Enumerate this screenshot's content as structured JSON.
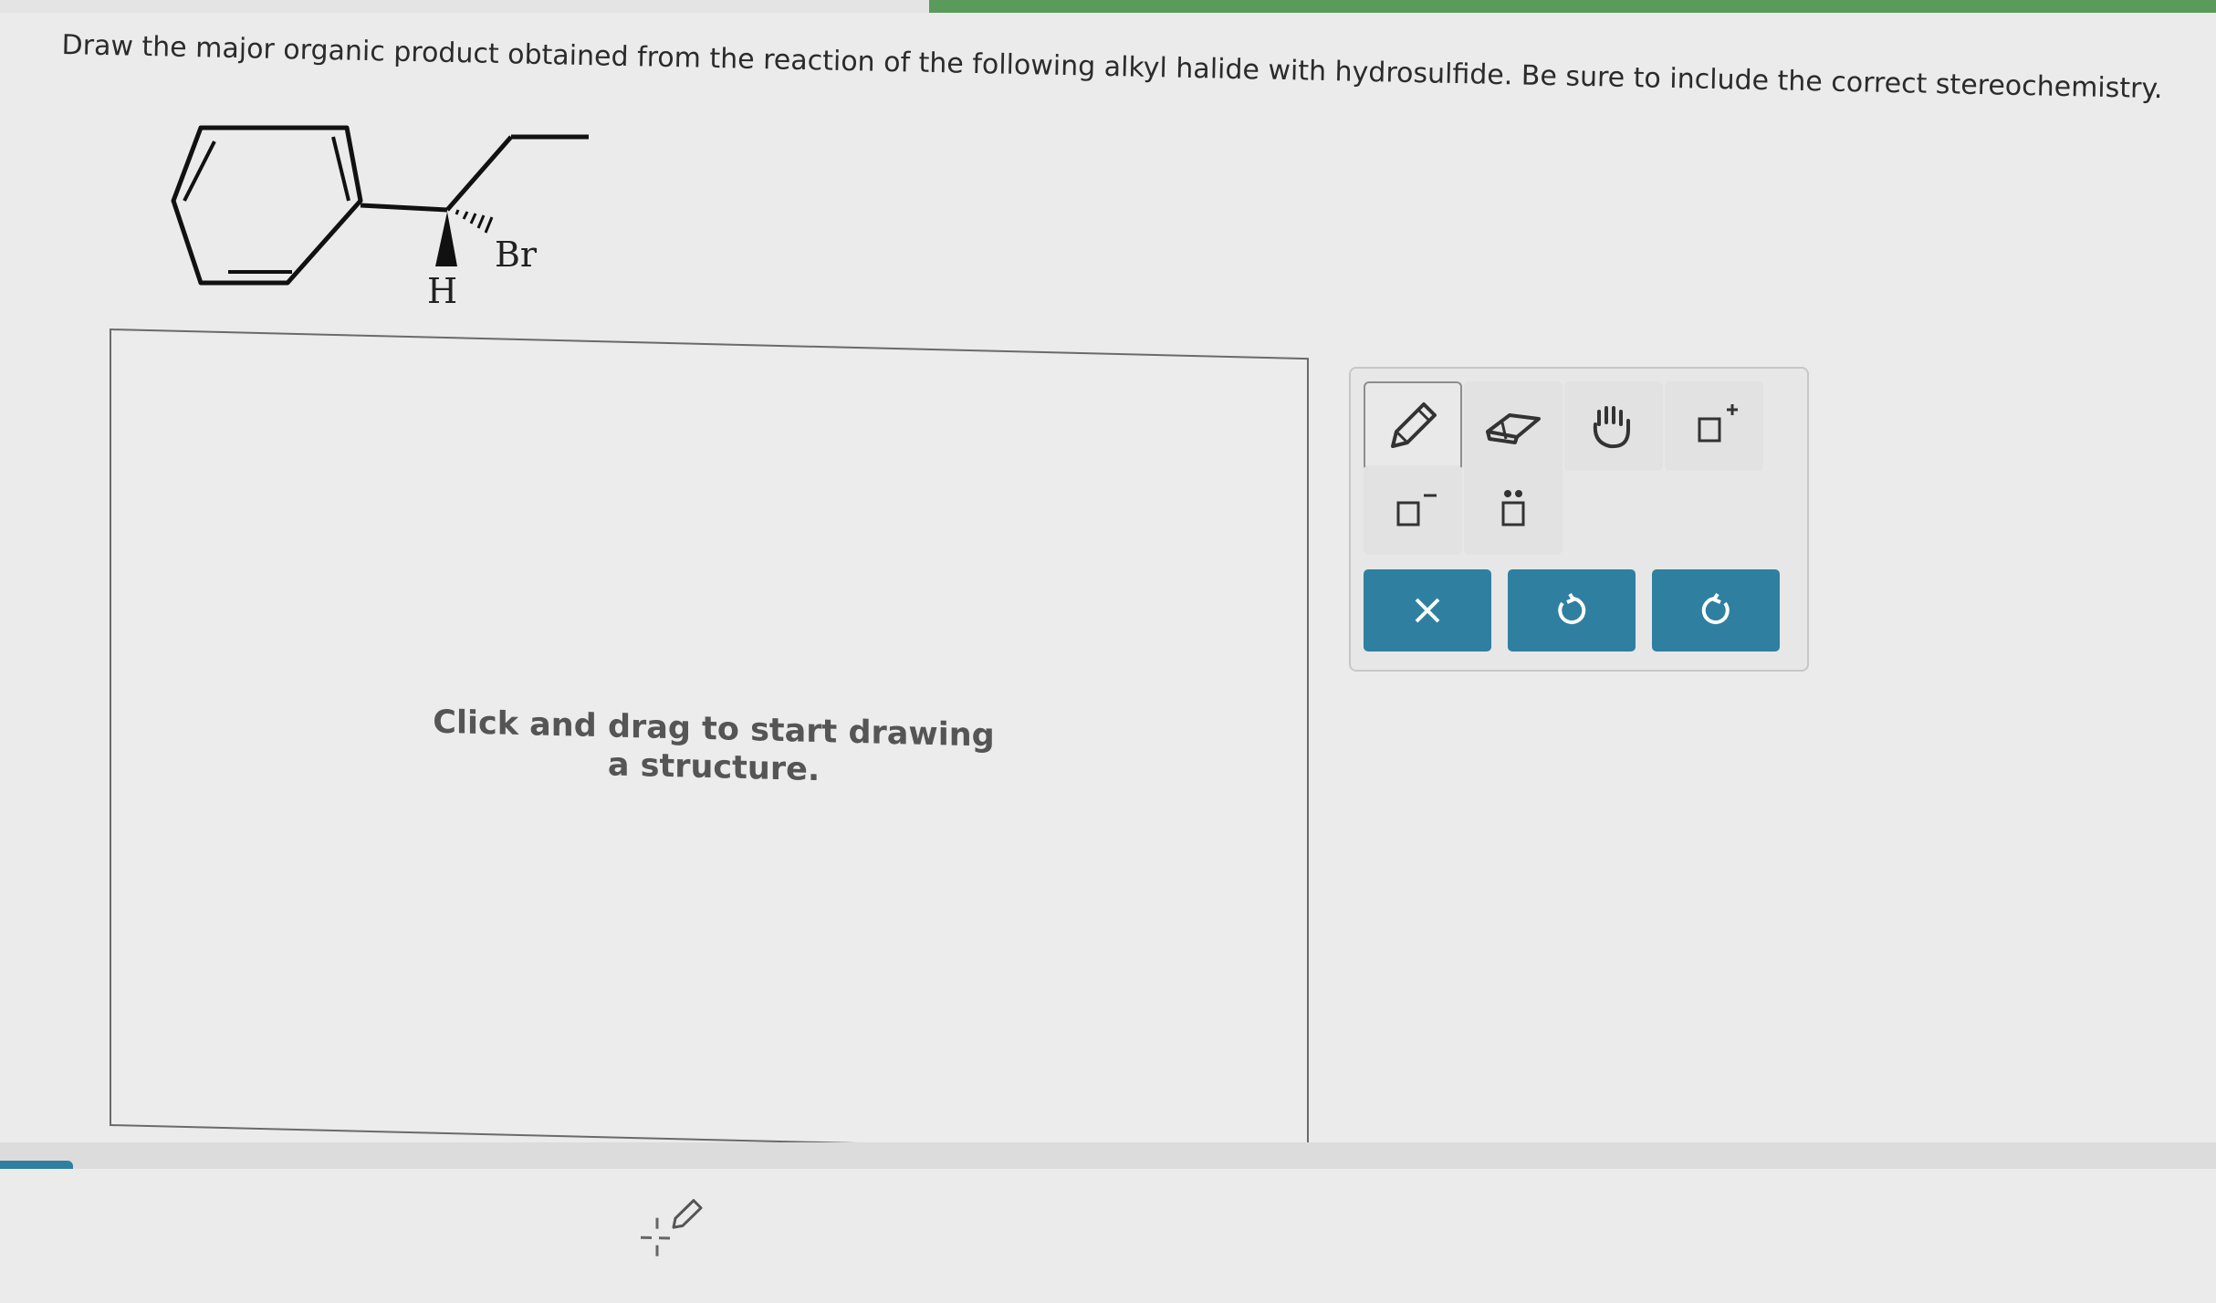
{
  "question": {
    "text": "Draw the major organic product obtained from the reaction of the following alkyl halide with hydrosulfide. Be sure to include the correct stereochemistry."
  },
  "molecule": {
    "atom_labels": [
      "Br",
      "H"
    ]
  },
  "canvas": {
    "hint": "Click and drag to start drawing a structure."
  },
  "toolbar": {
    "tools": [
      {
        "icon": "pencil-icon",
        "active": true
      },
      {
        "icon": "eraser-icon",
        "active": false
      },
      {
        "icon": "hand-icon",
        "active": false
      },
      {
        "icon": "positive-charge-icon",
        "active": false
      },
      {
        "icon": "negative-charge-icon",
        "active": false
      },
      {
        "icon": "lone-pair-icon",
        "active": false
      }
    ],
    "actions": [
      {
        "icon": "clear-icon",
        "symbol": "✕"
      },
      {
        "icon": "undo-icon",
        "symbol": "↺"
      },
      {
        "icon": "redo-icon",
        "symbol": "↻"
      }
    ]
  },
  "colors": {
    "action_button": "#2f7fa0",
    "accent_green": "#5a9a5a",
    "background": "#ebebeb"
  }
}
